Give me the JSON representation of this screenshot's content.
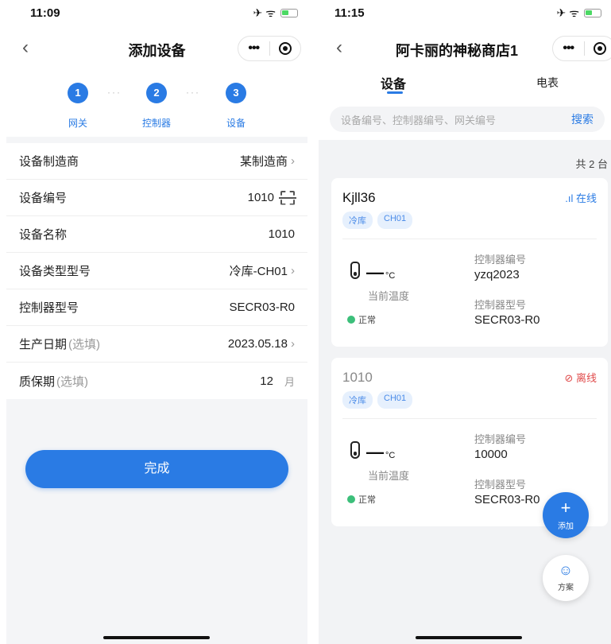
{
  "left_screen": {
    "status_time": "11:09",
    "nav_title": "添加设备",
    "steps": [
      {
        "number": "1",
        "label": "网关"
      },
      {
        "number": "2",
        "label": "控制器"
      },
      {
        "number": "3",
        "label": "设备"
      }
    ],
    "form": [
      {
        "label": "设备制造商",
        "optional": "",
        "value": "某制造商"
      },
      {
        "label": "设备编号",
        "optional": "",
        "value": "1010"
      },
      {
        "label": "设备名称",
        "optional": "",
        "value": "1010"
      },
      {
        "label": "设备类型型号",
        "optional": "",
        "value": "冷库-CH01"
      },
      {
        "label": "控制器型号",
        "optional": "",
        "value": "SECR03-R0"
      },
      {
        "label": "生产日期",
        "optional": "(选填)",
        "value": "2023.05.18"
      },
      {
        "label": "质保期",
        "optional": "(选填)",
        "value": "12",
        "unit": "月"
      }
    ],
    "done_label": "完成"
  },
  "right_screen": {
    "status_time": "11:15",
    "nav_title": "阿卡丽的神秘商店1",
    "tabs": [
      "设备",
      "电表"
    ],
    "search_placeholder": "设备编号、控制器编号、网关编号",
    "search_button": "搜索",
    "count_text": "共 2 台",
    "devices": [
      {
        "name": "Kjll36",
        "status": "在线",
        "tags": [
          "冷库",
          "CH01"
        ],
        "temp_value": "—",
        "temp_unit": "°C",
        "temp_label": "当前温度",
        "health": "正常",
        "controller_no_label": "控制器编号",
        "controller_no": "yzq2023",
        "controller_model_label": "控制器型号",
        "controller_model": "SECR03-R0"
      },
      {
        "name": "1010",
        "status": "离线",
        "tags": [
          "冷库",
          "CH01"
        ],
        "temp_value": "—",
        "temp_unit": "°C",
        "temp_label": "当前温度",
        "health": "正常",
        "controller_no_label": "控制器编号",
        "controller_no": "10000",
        "controller_model_label": "控制器型号",
        "controller_model": "SECR03-R0"
      }
    ],
    "fab_add_label": "添加",
    "fab_plan_label": "方案"
  },
  "colors": {
    "accent": "#2a7be4",
    "offline": "#e04b4b",
    "healthy": "#3cbf7a"
  },
  "icons": [
    "airplane-icon",
    "wifi-icon",
    "battery-icon",
    "back-icon",
    "more-icon",
    "target-icon",
    "scan-icon",
    "thermometer-icon",
    "signal-icon",
    "disconnect-icon",
    "plus-icon",
    "plan-icon"
  ]
}
